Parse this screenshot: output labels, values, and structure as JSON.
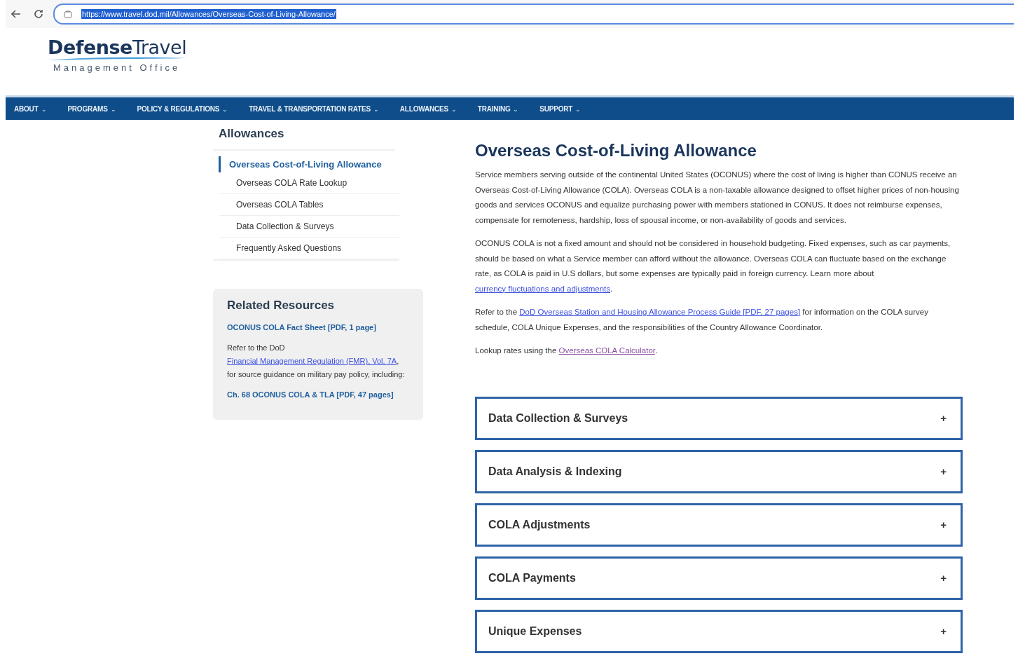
{
  "browser": {
    "url": "https://www.travel.dod.mil/Allowances/Overseas-Cost-of-Living-Allowance/"
  },
  "logo": {
    "title_bold": "Defense",
    "title_light": "Travel",
    "subtitle": "Management Office"
  },
  "nav": [
    {
      "label": "ABOUT",
      "caret": "⌄"
    },
    {
      "label": "PROGRAMS",
      "caret": "⌄"
    },
    {
      "label": "POLICY & REGULATIONS",
      "caret": "⌄"
    },
    {
      "label": "TRAVEL & TRANSPORTATION RATES",
      "caret": "⌄"
    },
    {
      "label": "ALLOWANCES",
      "caret": "⌄"
    },
    {
      "label": "TRAINING",
      "caret": "⌄"
    },
    {
      "label": "SUPPORT",
      "caret": "⌄"
    }
  ],
  "sidebar": {
    "title": "Allowances",
    "items": [
      {
        "label": "Overseas Cost-of-Living Allowance",
        "selected": true
      },
      {
        "label": "Overseas COLA Rate Lookup",
        "selected": false
      },
      {
        "label": "Overseas COLA Tables",
        "selected": false
      },
      {
        "label": "Data Collection & Surveys",
        "selected": false
      },
      {
        "label": "Frequently Asked Questions",
        "selected": false
      }
    ]
  },
  "related": {
    "title": "Related Resources",
    "blocks": [
      [
        {
          "kind": "bold_link",
          "text": "OCONUS COLA Fact Sheet [PDF, 1 page]"
        }
      ],
      [
        {
          "kind": "text",
          "text": "Refer to the DoD "
        },
        {
          "kind": "link",
          "text": "Financial Management Regulation (FMR), Vol. 7A"
        },
        {
          "kind": "text",
          "text": ", for source guidance on military pay policy, including:"
        }
      ],
      [
        {
          "kind": "bold_link",
          "text": "Ch. 68 OCONUS COLA & TLA [PDF, 47 pages]"
        }
      ]
    ]
  },
  "main": {
    "title": "Overseas Cost-of-Living Allowance",
    "paragraphs": [
      [
        {
          "kind": "text",
          "text": "Service members serving outside of the continental United States (OCONUS) where the cost of living is higher than CONUS receive an Overseas Cost-of-Living Allowance (COLA). Overseas COLA is a non-taxable allowance designed to offset higher prices of non-housing goods and services OCONUS and equalize purchasing power with members stationed in CONUS. It does not reimburse expenses, compensate for remoteness, hardship, loss of spousal income, or non-availability of goods and services."
        }
      ],
      [
        {
          "kind": "text",
          "text": "OCONUS COLA is not a fixed amount and should not be considered in household budgeting. Fixed expenses, such as car payments, should be based on what a Service member can afford without the allowance. Overseas COLA can fluctuate based on the exchange rate, as COLA is paid in U.S dollars, but some expenses are typically paid in foreign currency. Learn more about "
        },
        {
          "kind": "link",
          "text": "currency fluctuations and adjustments"
        },
        {
          "kind": "text",
          "text": "."
        }
      ],
      [
        {
          "kind": "text",
          "text": "Refer to the "
        },
        {
          "kind": "link",
          "text": "DoD Overseas Station and Housing Allowance Process Guide [PDF, 27 pages]"
        },
        {
          "kind": "text",
          "text": " for information on the COLA survey schedule, COLA Unique Expenses, and the responsibilities of the Country Allowance Coordinator."
        }
      ],
      [
        {
          "kind": "text",
          "text": "Lookup rates using the "
        },
        {
          "kind": "visited_link",
          "text": "Overseas COLA Calculator"
        },
        {
          "kind": "text",
          "text": "."
        }
      ]
    ],
    "accordions": [
      {
        "title": "Data Collection & Surveys",
        "icon": "+",
        "expanded": false
      },
      {
        "title": "Data Analysis & Indexing",
        "icon": "+",
        "expanded": false
      },
      {
        "title": "COLA Adjustments",
        "icon": "+",
        "expanded": false
      },
      {
        "title": "COLA Payments",
        "icon": "+",
        "expanded": false
      },
      {
        "title": "Unique Expenses",
        "icon": "+",
        "expanded": false
      }
    ]
  }
}
